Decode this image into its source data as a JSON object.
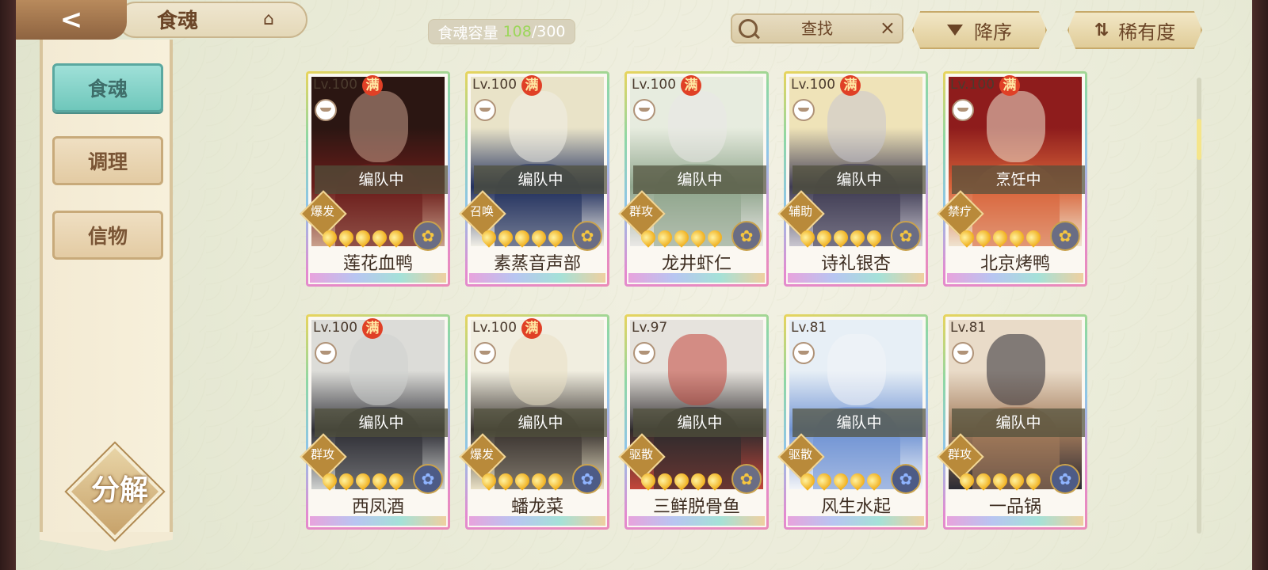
{
  "header": {
    "title": "食魂",
    "back_icon": "back-arrow-icon",
    "home_icon": "pavilion-home-icon",
    "capacity_label": "食魂容量",
    "capacity_current": "108",
    "capacity_sep_max": "/300",
    "search_placeholder": "查找",
    "clear_icon": "×",
    "sort_label": "降序",
    "rarity_label": "稀有度"
  },
  "sidebar": {
    "tabs": [
      {
        "label": "食魂",
        "active": true
      },
      {
        "label": "调理",
        "active": false
      },
      {
        "label": "信物",
        "active": false
      }
    ],
    "decompose_label": "分解"
  },
  "common": {
    "full_mark": "满"
  },
  "cards": [
    {
      "level": "Lv.100",
      "full": true,
      "status": "编队中",
      "role": "爆发",
      "name": "莲花血鸭",
      "badge": "gold",
      "palette": [
        "#2b1612",
        "#6b1d1a",
        "#c9a08c"
      ]
    },
    {
      "level": "Lv.100",
      "full": true,
      "status": "编队中",
      "role": "召唤",
      "name": "素蒸音声部",
      "badge": "gold",
      "palette": [
        "#e9e3c8",
        "#22305e",
        "#f1efe6"
      ]
    },
    {
      "level": "Lv.100",
      "full": true,
      "status": "编队中",
      "role": "群攻",
      "name": "龙井虾仁",
      "badge": "gold",
      "palette": [
        "#e7ecdf",
        "#8fa58c",
        "#eae8e6"
      ]
    },
    {
      "level": "Lv.100",
      "full": true,
      "status": "编队中",
      "role": "辅助",
      "name": "诗礼银杏",
      "badge": "gold",
      "palette": [
        "#efe3b8",
        "#3f3c54",
        "#c9c6cf"
      ]
    },
    {
      "level": "Lv.100",
      "full": true,
      "status": "烹饪中",
      "role": "禁疗",
      "name": "北京烤鸭",
      "badge": "gold",
      "palette": [
        "#8e1c1c",
        "#d8643a",
        "#efe3cf"
      ]
    },
    {
      "level": "Lv.100",
      "full": true,
      "status": "编队中",
      "role": "群攻",
      "name": "西凤酒",
      "badge": "blue",
      "palette": [
        "#dcdcd8",
        "#2f2f36",
        "#cfd1cf"
      ]
    },
    {
      "level": "Lv.100",
      "full": true,
      "status": "编队中",
      "role": "爆发",
      "name": "蟠龙菜",
      "badge": "blue",
      "palette": [
        "#f1eee0",
        "#3a3430",
        "#e9e0c5"
      ]
    },
    {
      "level": "Lv.97",
      "full": false,
      "status": "编队中",
      "role": "驱散",
      "name": "三鲜脱骨鱼",
      "badge": "gold",
      "palette": [
        "#e6e3dd",
        "#2f2b2d",
        "#c3463a"
      ]
    },
    {
      "level": "Lv.81",
      "full": false,
      "status": "编队中",
      "role": "驱散",
      "name": "风生水起",
      "badge": "blue",
      "palette": [
        "#e7eff6",
        "#6f93d3",
        "#f2f4f8"
      ]
    },
    {
      "level": "Lv.81",
      "full": false,
      "status": "编队中",
      "role": "群攻",
      "name": "一品锅",
      "badge": "blue",
      "palette": [
        "#e9dbc8",
        "#a27a5a",
        "#2b2a33"
      ]
    }
  ]
}
